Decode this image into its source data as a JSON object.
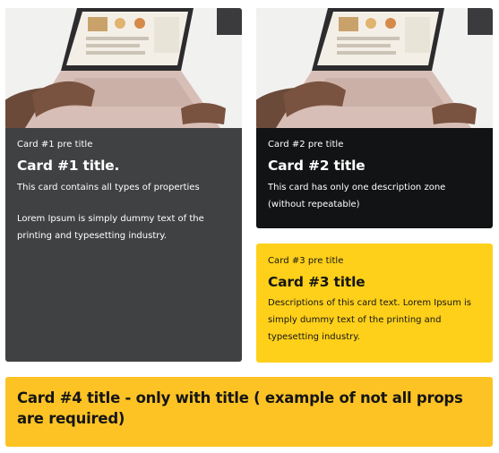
{
  "cards": [
    {
      "pretitle": "Card #1 pre title",
      "title": "Card #1 title.",
      "descriptions": [
        "This card contains all types of properties",
        "Lorem Ipsum is simply dummy text of the printing and typesetting industry."
      ],
      "background": "#404143",
      "text_color": "#ffffff",
      "image_icon": "laptop-photo"
    },
    {
      "pretitle": "Card #2 pre title",
      "title": "Card #2 title",
      "descriptions": [
        "This card has only one description zone (without repeatable)"
      ],
      "background": "#121314",
      "text_color": "#ffffff",
      "image_icon": "laptop-photo"
    },
    {
      "pretitle": "Card #3 pre title",
      "title": "Card #3 title",
      "descriptions": [
        "Descriptions of this card text. Lorem Ipsum is simply dummy text of the printing and typesetting industry."
      ],
      "background": "#fed01a",
      "text_color": "#151515"
    },
    {
      "title": "Card #4 title - only with title ( example of not all props are required)",
      "background": "#fdc325",
      "text_color": "#151515"
    }
  ]
}
